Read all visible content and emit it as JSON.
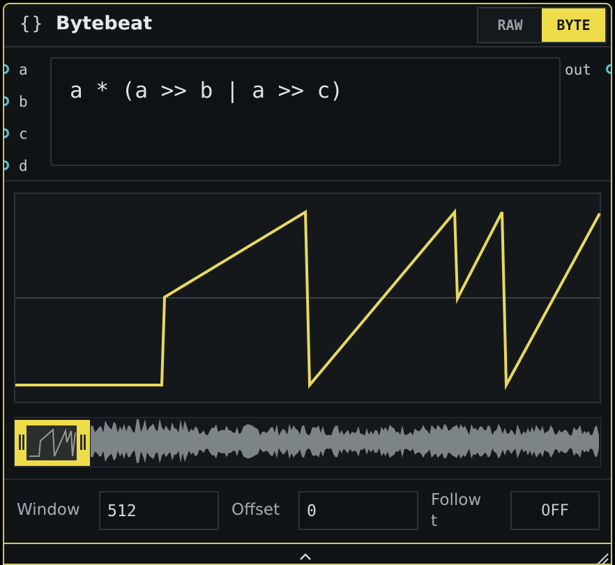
{
  "node": {
    "title": "Bytebeat",
    "braces": "{}",
    "modes": {
      "raw": "RAW",
      "byte": "BYTE",
      "active": "BYTE"
    },
    "expression": "a * (a >> b | a >> c)"
  },
  "ports": {
    "inputs": [
      "a",
      "b",
      "c",
      "d"
    ],
    "output": "out"
  },
  "controls": {
    "window_label": "Window",
    "window_value": "512",
    "offset_label": "Offset",
    "offset_value": "0",
    "follow_label_1": "Follow",
    "follow_label_2": "t",
    "follow_value": "OFF"
  },
  "colors": {
    "accent": "#eedc4a",
    "border": "#d4c85a",
    "port": "#57c5dc",
    "background": "#111417",
    "overview_wave": "#7d8487"
  },
  "icons": {
    "collapse": "chevron-up-icon",
    "resize": "resize-grip-icon"
  }
}
